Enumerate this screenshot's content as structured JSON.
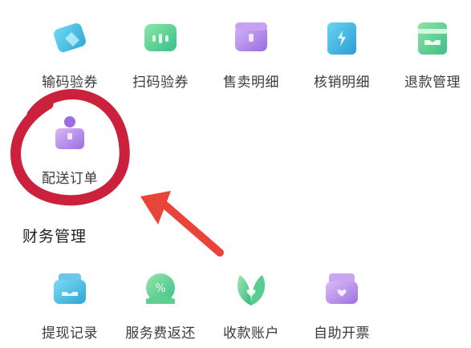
{
  "row1": [
    {
      "label": "输码验券",
      "icon": "ticket-pen-icon"
    },
    {
      "label": "扫码验券",
      "icon": "scan-code-icon"
    },
    {
      "label": "售卖明细",
      "icon": "sales-box-icon"
    },
    {
      "label": "核销明细",
      "icon": "verify-ticket-icon"
    },
    {
      "label": "退款管理",
      "icon": "refund-card-icon"
    }
  ],
  "row2": [
    {
      "label": "配送订单",
      "icon": "delivery-person-icon"
    }
  ],
  "finance": {
    "title": "财务管理",
    "items": [
      {
        "label": "提现记录",
        "icon": "withdraw-card-icon"
      },
      {
        "label": "服务费返还",
        "icon": "fee-return-icon"
      },
      {
        "label": "收款账户",
        "icon": "leaf-account-icon"
      },
      {
        "label": "自助开票",
        "icon": "invoice-heart-icon"
      }
    ]
  },
  "colors": {
    "annotation_red": "#c8102e",
    "arrow_red": "#e8443a",
    "icon_blue": "#4cc3e0",
    "icon_green": "#5fd18a",
    "icon_purple": "#b58be8"
  }
}
